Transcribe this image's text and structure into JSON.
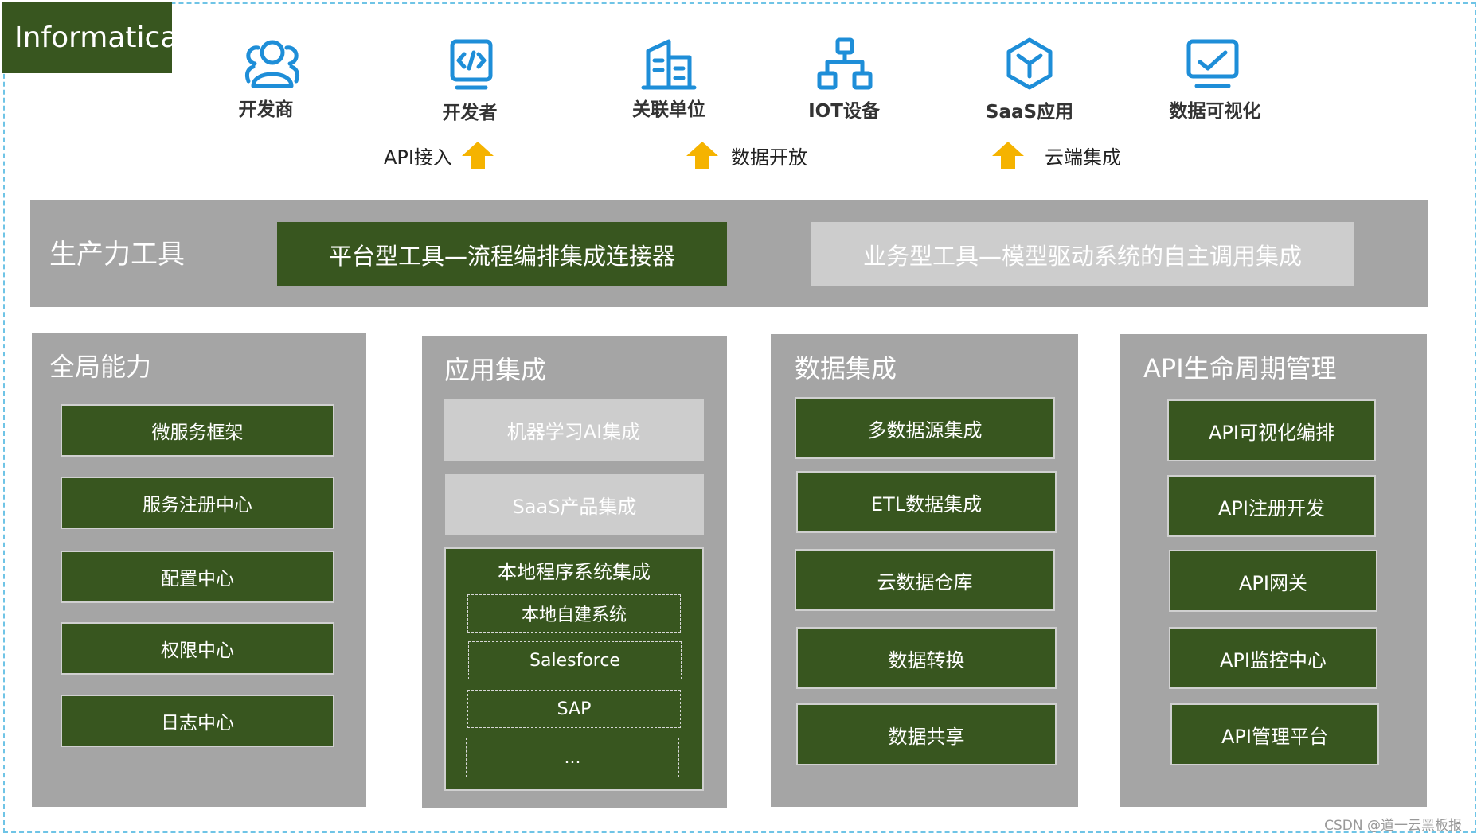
{
  "brand": "Informatica",
  "roles": [
    {
      "label": "开发商",
      "icon": "users-icon"
    },
    {
      "label": "开发者",
      "icon": "code-window-icon"
    },
    {
      "label": "关联单位",
      "icon": "building-icon"
    },
    {
      "label": "IOT设备",
      "icon": "network-nodes-icon"
    },
    {
      "label": "SaaS应用",
      "icon": "cube-hexagon-icon"
    },
    {
      "label": "数据可视化",
      "icon": "monitor-chart-icon"
    }
  ],
  "flows": [
    "API接入",
    "数据开放",
    "云端集成"
  ],
  "productivity": {
    "title": "生产力工具",
    "platform_tool": "平台型工具—流程编排集成连接器",
    "business_tool": "业务型工具—模型驱动系统的自主调用集成"
  },
  "global": {
    "title": "全局能力",
    "items": [
      "微服务框架",
      "服务注册中心",
      "配置中心",
      "权限中心",
      "日志中心"
    ]
  },
  "app": {
    "title": "应用集成",
    "items": [
      "机器学习AI集成",
      "SaaS产品集成"
    ],
    "local": {
      "title": "本地程序系统集成",
      "items": [
        "本地自建系统",
        "Salesforce",
        "SAP",
        "..."
      ]
    }
  },
  "data": {
    "title": "数据集成",
    "items": [
      "多数据源集成",
      "ETL数据集成",
      "云数据仓库",
      "数据转换",
      "数据共享"
    ]
  },
  "api": {
    "title": "API生命周期管理",
    "items": [
      "API可视化编排",
      "API注册开发",
      "API网关",
      "API监控中心",
      "API管理平台"
    ]
  },
  "watermark": "CSDN @道一云黑板报",
  "colors": {
    "green": "#38561f",
    "gray_bar": "#a5a5a5",
    "light_gray": "#cdcdcd",
    "icon_blue": "#1e8ed8",
    "arrow_orange": "#f5b300",
    "frame_border": "#6fc4e6"
  }
}
